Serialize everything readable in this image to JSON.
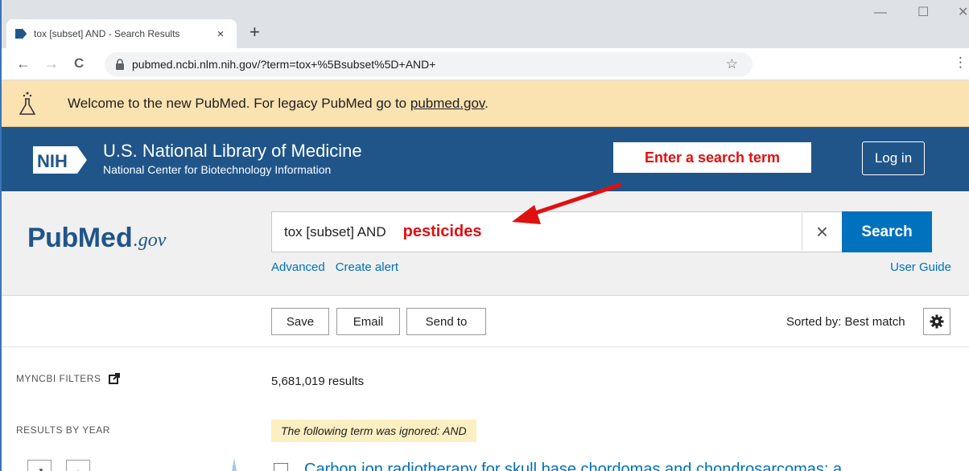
{
  "browser": {
    "tab_title": "tox [subset] AND - Search Results",
    "tab_close": "×",
    "new_tab": "+",
    "url": "pubmed.ncbi.nlm.nih.gov/?term=tox+%5Bsubset%5D+AND+",
    "back": "←",
    "forward": "→",
    "reload": "C",
    "star": "☆",
    "menu": "⋮",
    "minimize": "—",
    "maximize": "☐",
    "close_window": "✕"
  },
  "banner": {
    "message": "Welcome to the new PubMed. For legacy PubMed go to ",
    "link": "pubmed.gov",
    "suffix": "."
  },
  "nih": {
    "logo_text": "NIH",
    "title": "U.S. National Library of Medicine",
    "subtitle": "National Center for Biotechnology Information",
    "login": "Log in"
  },
  "annotation": {
    "callout": "Enter a search term",
    "highlight_term": "pesticides",
    "color": "#e01010"
  },
  "pubmed": {
    "logo_pub": "Pub",
    "logo_med": "Med",
    "logo_gov": ".gov"
  },
  "search": {
    "value": "tox [subset] AND",
    "clear": "×",
    "button": "Search",
    "advanced": "Advanced",
    "create_alert": "Create alert",
    "user_guide": "User Guide"
  },
  "actions": {
    "save": "Save",
    "email": "Email",
    "send_to": "Send to",
    "sorted_by": "Sorted by: Best match"
  },
  "sidebar": {
    "myncbi_filters": "MYNCBI FILTERS",
    "results_by_year": "RESULTS BY YEAR",
    "expand": "↗",
    "download": "↓"
  },
  "results": {
    "count": "5,681,019 results",
    "ignored_notice": "The following term was ignored: AND",
    "first_title": "Carbon ion radiotherapy for skull base chordomas and chondrosarcomas: a"
  },
  "colors": {
    "nih_blue": "#20558a",
    "link_blue": "#0071bc",
    "banner": "#fae2b1"
  }
}
